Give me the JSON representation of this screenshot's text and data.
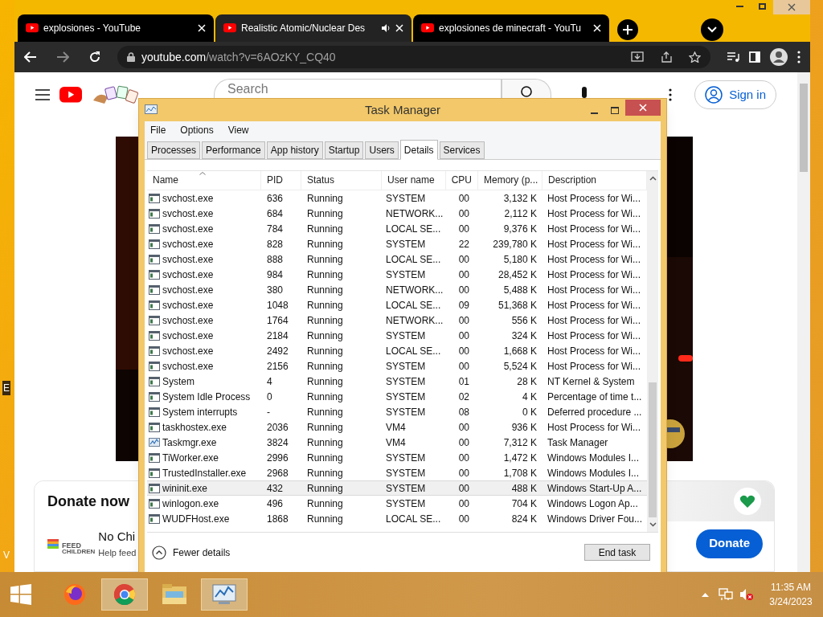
{
  "desktop_labels": [
    "E",
    "V"
  ],
  "browser": {
    "tabs": [
      {
        "title": "explosiones - YouTube",
        "selected": false,
        "audio": false
      },
      {
        "title": "Realistic Atomic/Nuclear Des",
        "selected": true,
        "audio": true
      },
      {
        "title": "explosiones de minecraft - YouTu",
        "selected": false,
        "audio": false
      }
    ],
    "address": {
      "host": "youtube.com",
      "path": "/watch?v=6AOzKY_CQ40"
    }
  },
  "youtube": {
    "search_placeholder": "Search",
    "sign_in": "Sign in"
  },
  "donate": {
    "title": "Donate now",
    "org": "No Chi",
    "tagline": "Help feed",
    "logo_top": "FEED",
    "logo_bottom": "CHILDREN",
    "button": "Donate"
  },
  "task_manager": {
    "title": "Task Manager",
    "menu": [
      "File",
      "Options",
      "View"
    ],
    "tabs": [
      {
        "label": "Processes",
        "selected": false
      },
      {
        "label": "Performance",
        "selected": false
      },
      {
        "label": "App history",
        "selected": false
      },
      {
        "label": "Startup",
        "selected": false
      },
      {
        "label": "Users",
        "selected": false
      },
      {
        "label": "Details",
        "selected": true
      },
      {
        "label": "Services",
        "selected": false
      }
    ],
    "columns": [
      "Name",
      "PID",
      "Status",
      "User name",
      "CPU",
      "Memory (p...",
      "Description"
    ],
    "rows": [
      {
        "kind": "service",
        "name": "svchost.exe",
        "pid": "636",
        "status": "Running",
        "user": "SYSTEM",
        "cpu": "00",
        "memory": "3,132 K",
        "description": "Host Process for Wi...",
        "selected": false
      },
      {
        "kind": "service",
        "name": "svchost.exe",
        "pid": "684",
        "status": "Running",
        "user": "NETWORK...",
        "cpu": "00",
        "memory": "2,112 K",
        "description": "Host Process for Wi...",
        "selected": false
      },
      {
        "kind": "service",
        "name": "svchost.exe",
        "pid": "784",
        "status": "Running",
        "user": "LOCAL SE...",
        "cpu": "00",
        "memory": "9,376 K",
        "description": "Host Process for Wi...",
        "selected": false
      },
      {
        "kind": "service",
        "name": "svchost.exe",
        "pid": "828",
        "status": "Running",
        "user": "SYSTEM",
        "cpu": "22",
        "memory": "239,780 K",
        "description": "Host Process for Wi...",
        "selected": false
      },
      {
        "kind": "service",
        "name": "svchost.exe",
        "pid": "888",
        "status": "Running",
        "user": "LOCAL SE...",
        "cpu": "00",
        "memory": "5,180 K",
        "description": "Host Process for Wi...",
        "selected": false
      },
      {
        "kind": "service",
        "name": "svchost.exe",
        "pid": "984",
        "status": "Running",
        "user": "SYSTEM",
        "cpu": "00",
        "memory": "28,452 K",
        "description": "Host Process for Wi...",
        "selected": false
      },
      {
        "kind": "service",
        "name": "svchost.exe",
        "pid": "380",
        "status": "Running",
        "user": "NETWORK...",
        "cpu": "00",
        "memory": "5,488 K",
        "description": "Host Process for Wi...",
        "selected": false
      },
      {
        "kind": "service",
        "name": "svchost.exe",
        "pid": "1048",
        "status": "Running",
        "user": "LOCAL SE...",
        "cpu": "09",
        "memory": "51,368 K",
        "description": "Host Process for Wi...",
        "selected": false
      },
      {
        "kind": "service",
        "name": "svchost.exe",
        "pid": "1764",
        "status": "Running",
        "user": "NETWORK...",
        "cpu": "00",
        "memory": "556 K",
        "description": "Host Process for Wi...",
        "selected": false
      },
      {
        "kind": "service",
        "name": "svchost.exe",
        "pid": "2184",
        "status": "Running",
        "user": "SYSTEM",
        "cpu": "00",
        "memory": "324 K",
        "description": "Host Process for Wi...",
        "selected": false
      },
      {
        "kind": "service",
        "name": "svchost.exe",
        "pid": "2492",
        "status": "Running",
        "user": "LOCAL SE...",
        "cpu": "00",
        "memory": "1,668 K",
        "description": "Host Process for Wi...",
        "selected": false
      },
      {
        "kind": "service",
        "name": "svchost.exe",
        "pid": "2156",
        "status": "Running",
        "user": "SYSTEM",
        "cpu": "00",
        "memory": "5,524 K",
        "description": "Host Process for Wi...",
        "selected": false
      },
      {
        "kind": "service",
        "name": "System",
        "pid": "4",
        "status": "Running",
        "user": "SYSTEM",
        "cpu": "01",
        "memory": "28 K",
        "description": "NT Kernel & System",
        "selected": false
      },
      {
        "kind": "service",
        "name": "System Idle Process",
        "pid": "0",
        "status": "Running",
        "user": "SYSTEM",
        "cpu": "02",
        "memory": "4 K",
        "description": "Percentage of time t...",
        "selected": false
      },
      {
        "kind": "service",
        "name": "System interrupts",
        "pid": "-",
        "status": "Running",
        "user": "SYSTEM",
        "cpu": "08",
        "memory": "0 K",
        "description": "Deferred procedure ...",
        "selected": false
      },
      {
        "kind": "service",
        "name": "taskhostex.exe",
        "pid": "2036",
        "status": "Running",
        "user": "VM4",
        "cpu": "00",
        "memory": "936 K",
        "description": "Host Process for Wi...",
        "selected": false
      },
      {
        "kind": "monitor",
        "name": "Taskmgr.exe",
        "pid": "3824",
        "status": "Running",
        "user": "VM4",
        "cpu": "00",
        "memory": "7,312 K",
        "description": "Task Manager",
        "selected": false
      },
      {
        "kind": "service",
        "name": "TiWorker.exe",
        "pid": "2996",
        "status": "Running",
        "user": "SYSTEM",
        "cpu": "00",
        "memory": "1,472 K",
        "description": "Windows Modules I...",
        "selected": false
      },
      {
        "kind": "service",
        "name": "TrustedInstaller.exe",
        "pid": "2968",
        "status": "Running",
        "user": "SYSTEM",
        "cpu": "00",
        "memory": "1,708 K",
        "description": "Windows Modules I...",
        "selected": false
      },
      {
        "kind": "service",
        "name": "wininit.exe",
        "pid": "432",
        "status": "Running",
        "user": "SYSTEM",
        "cpu": "00",
        "memory": "488 K",
        "description": "Windows Start-Up A...",
        "selected": true
      },
      {
        "kind": "service",
        "name": "winlogon.exe",
        "pid": "496",
        "status": "Running",
        "user": "SYSTEM",
        "cpu": "00",
        "memory": "704 K",
        "description": "Windows Logon Ap...",
        "selected": false
      },
      {
        "kind": "service",
        "name": "WUDFHost.exe",
        "pid": "1868",
        "status": "Running",
        "user": "LOCAL SE...",
        "cpu": "00",
        "memory": "824 K",
        "description": "Windows Driver Fou...",
        "selected": false
      }
    ],
    "fewer_details": "Fewer details",
    "end_task": "End task"
  },
  "taskbar": {
    "apps": [
      {
        "kind": "firefox",
        "selected": false
      },
      {
        "kind": "chrome",
        "selected": true
      },
      {
        "kind": "explorer",
        "selected": false
      },
      {
        "kind": "taskmgr",
        "selected": true
      }
    ],
    "time": "11:35 AM",
    "date": "3/24/2023"
  }
}
